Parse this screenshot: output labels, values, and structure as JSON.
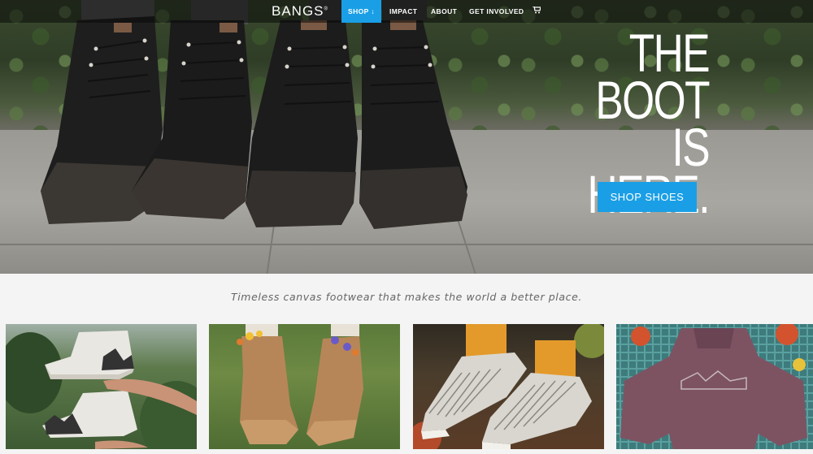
{
  "nav": {
    "logo": "BANGS",
    "logo_mark": "®",
    "items": [
      {
        "label": "SHOP ↓",
        "active": true
      },
      {
        "label": "IMPACT",
        "active": false
      },
      {
        "label": "ABOUT",
        "active": false
      },
      {
        "label": "GET INVOLVED",
        "active": false
      }
    ],
    "cart_icon": "shopping-cart-icon"
  },
  "hero": {
    "title_line1": "THE BOOT",
    "title_line2": "IS HERE.",
    "cta_label": "SHOP SHOES"
  },
  "tagline": "Timeless canvas footwear that makes the world a better place.",
  "colors": {
    "accent": "#1a9fe6",
    "background": "#f4f4f4"
  },
  "tiles": [
    {
      "name": "white-mountain-high-tops"
    },
    {
      "name": "tan-sneakers-with-flowers"
    },
    {
      "name": "striped-slip-ons"
    },
    {
      "name": "mauve-hoodie"
    }
  ]
}
